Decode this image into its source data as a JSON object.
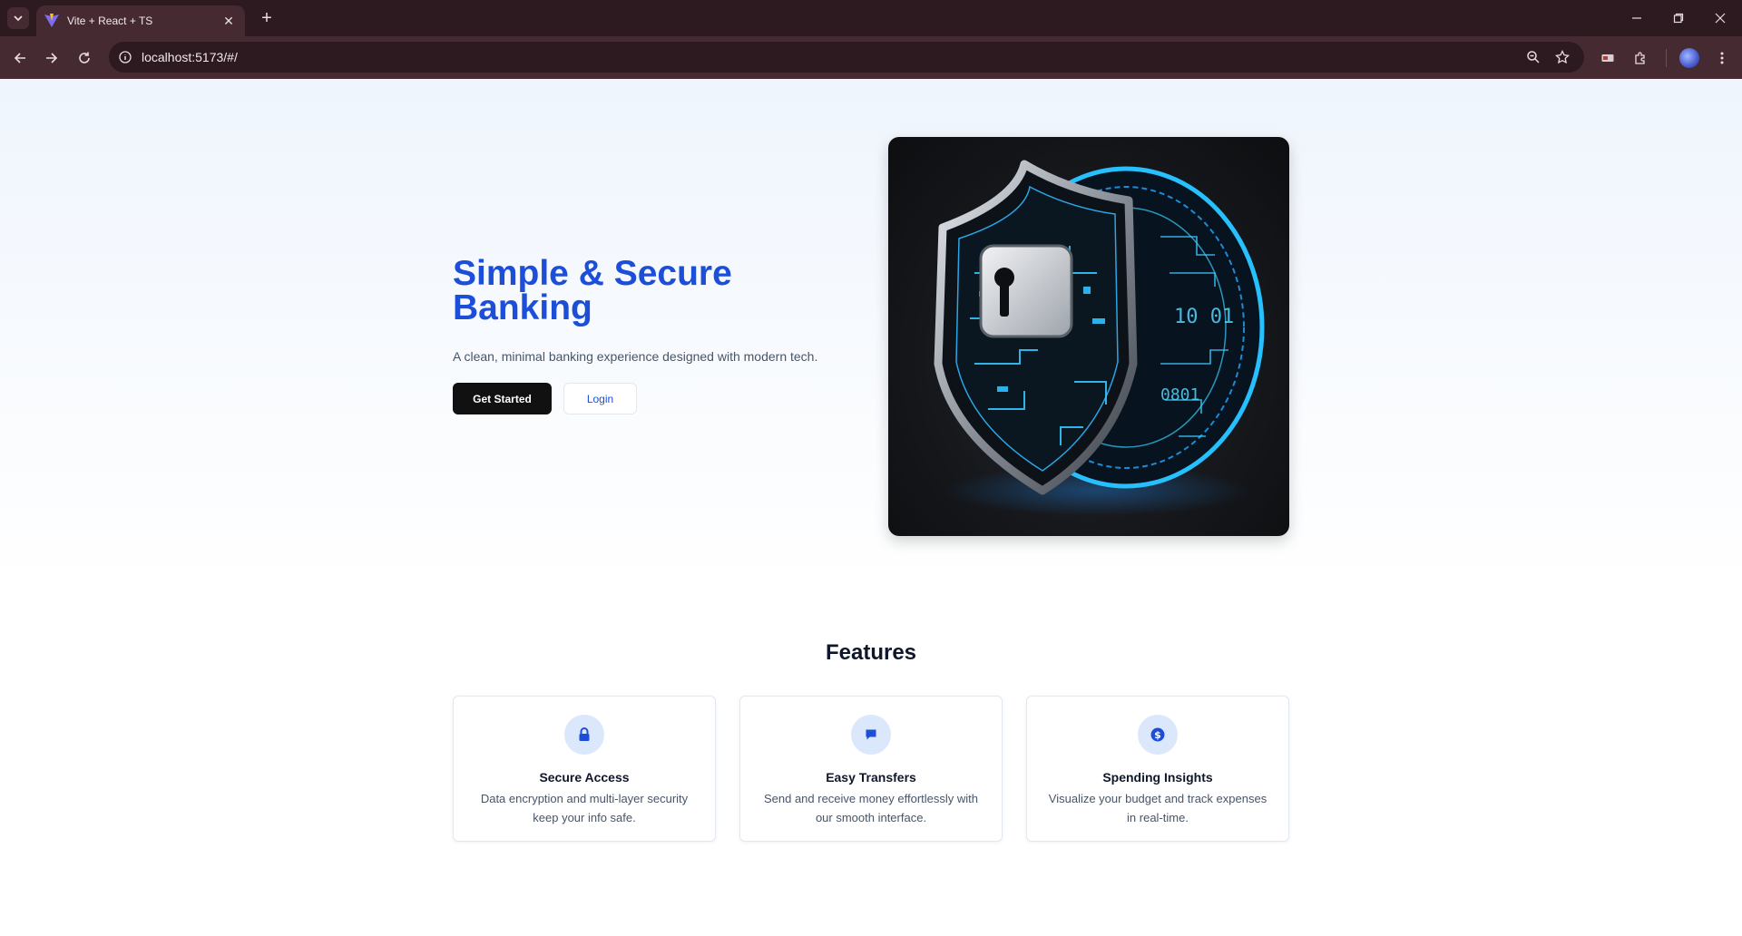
{
  "browser": {
    "tab_title": "Vite + React + TS",
    "url": "localhost:5173/#/"
  },
  "hero": {
    "title": "Simple & Secure Banking",
    "subtitle": "A clean, minimal banking experience designed with modern tech.",
    "primary_button": "Get Started",
    "secondary_button": "Login",
    "image_icon": "shield-padlock-illustration"
  },
  "features": {
    "title": "Features",
    "cards": [
      {
        "icon": "lock-icon",
        "title": "Secure Access",
        "description": "Data encryption and multi-layer security keep your info safe."
      },
      {
        "icon": "chat-icon",
        "title": "Easy Transfers",
        "description": "Send and receive money effortlessly with our smooth interface."
      },
      {
        "icon": "dollar-icon",
        "title": "Spending Insights",
        "description": "Visualize your budget and track expenses in real-time."
      }
    ]
  },
  "colors": {
    "accent": "#1d4ed8",
    "chrome_dark": "#2c1a20",
    "chrome": "#452a32"
  }
}
